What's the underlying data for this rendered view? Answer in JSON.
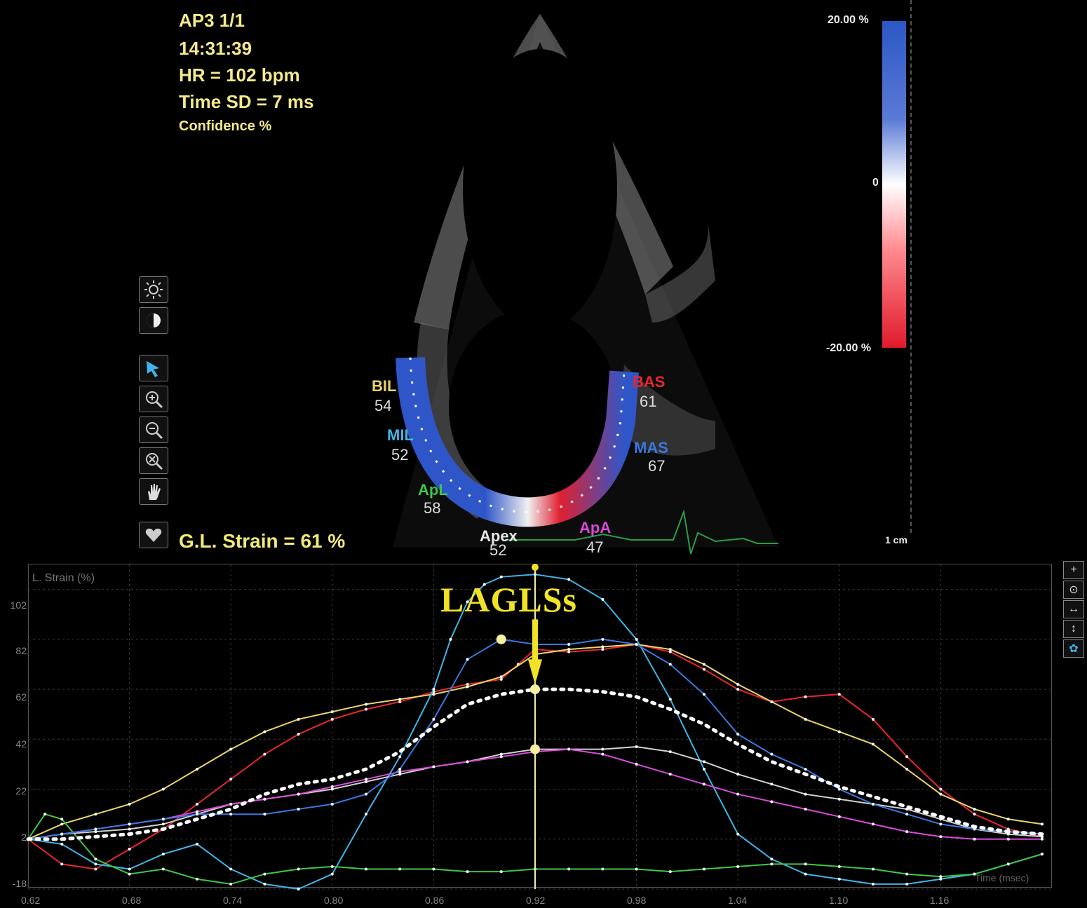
{
  "image_panel": {
    "info": {
      "view": "AP3  1/1",
      "time": "14:31:39",
      "hr": "HR = 102 bpm",
      "time_sd": "Time SD = 7 ms",
      "confidence": "Confidence %"
    },
    "global_strain": "G.L. Strain = 61 %",
    "color_scale": {
      "top_label": "20.00 %",
      "mid_label": "0",
      "bottom_label": "-20.00 %",
      "top_color": "#2b57c4",
      "bottom_color": "#e01a2a"
    },
    "depth_label": "1 cm",
    "segments": [
      {
        "id": "bil",
        "label": "BIL",
        "value": "54",
        "color": "#e8d46a"
      },
      {
        "id": "mil",
        "label": "MIL",
        "value": "52",
        "color": "#3fb5e8"
      },
      {
        "id": "apl",
        "label": "ApL",
        "value": "58",
        "color": "#3fc54a"
      },
      {
        "id": "apex",
        "label": "Apex",
        "value": "52",
        "color": "#e8e8e8"
      },
      {
        "id": "apa",
        "label": "ApA",
        "value": "47",
        "color": "#d94ad9"
      },
      {
        "id": "mas",
        "label": "MAS",
        "value": "67",
        "color": "#3a78e0"
      },
      {
        "id": "bas",
        "label": "BAS",
        "value": "61",
        "color": "#e8262e"
      }
    ],
    "tools": [
      "sun-icon",
      "contrast-icon",
      "pointer-icon",
      "zoom-in-icon",
      "zoom-out-icon",
      "zoom-reset-icon",
      "hand-icon",
      "heart-icon"
    ]
  },
  "graph": {
    "ylabel": "L. Strain (%)",
    "annotation": "LAGLSs",
    "xlabel": "Time (msec)",
    "tools": [
      "+",
      "⊙",
      "↔",
      "↕",
      "✿"
    ],
    "y_ticks": [
      "102",
      "82",
      "62",
      "42",
      "22",
      "2",
      "-18"
    ],
    "x_ticks": [
      "0.62",
      "0.68",
      "0.74",
      "0.80",
      "0.86",
      "0.92",
      "0.98",
      "1.04",
      "1.10",
      "1.16"
    ],
    "marker_time": "0.92"
  },
  "chart_data": {
    "type": "line",
    "ylabel": "L. Strain (%)",
    "xlabel": "Time (msec)",
    "ylim": [
      -18,
      112
    ],
    "xlim": [
      0.62,
      1.225
    ],
    "grid": true,
    "annotations": [
      "LAGLSs"
    ],
    "series": [
      {
        "name": "BAS",
        "color": "#e8262e",
        "x": [
          0.62,
          0.64,
          0.66,
          0.68,
          0.7,
          0.72,
          0.74,
          0.76,
          0.78,
          0.8,
          0.82,
          0.84,
          0.86,
          0.88,
          0.9,
          0.91,
          0.92,
          0.94,
          0.96,
          0.98,
          1.0,
          1.02,
          1.04,
          1.06,
          1.08,
          1.1,
          1.12,
          1.14,
          1.16,
          1.18,
          1.2,
          1.22
        ],
        "y": [
          2,
          -8,
          -10,
          -2,
          6,
          16,
          26,
          36,
          44,
          50,
          54,
          57,
          61,
          64,
          66,
          72,
          78,
          77,
          78,
          80,
          77,
          70,
          62,
          57,
          59,
          60,
          50,
          35,
          22,
          12,
          6,
          3
        ]
      },
      {
        "name": "BIL",
        "color": "#e8d46a",
        "x": [
          0.62,
          0.64,
          0.66,
          0.68,
          0.7,
          0.72,
          0.74,
          0.76,
          0.78,
          0.8,
          0.82,
          0.84,
          0.86,
          0.88,
          0.9,
          0.92,
          0.94,
          0.96,
          0.98,
          1.0,
          1.02,
          1.04,
          1.06,
          1.08,
          1.1,
          1.12,
          1.14,
          1.16,
          1.18,
          1.2,
          1.22
        ],
        "y": [
          2,
          8,
          12,
          16,
          22,
          30,
          38,
          45,
          50,
          53,
          56,
          58,
          60,
          63,
          67,
          76,
          78,
          79,
          80,
          78,
          72,
          64,
          57,
          50,
          45,
          40,
          30,
          20,
          14,
          10,
          8
        ]
      },
      {
        "name": "MIL",
        "color": "#3fb5e8",
        "x": [
          0.62,
          0.64,
          0.66,
          0.68,
          0.7,
          0.72,
          0.74,
          0.76,
          0.78,
          0.8,
          0.82,
          0.84,
          0.86,
          0.87,
          0.88,
          0.89,
          0.9,
          0.92,
          0.94,
          0.96,
          0.98,
          1.0,
          1.02,
          1.04,
          1.06,
          1.08,
          1.1,
          1.12,
          1.14,
          1.16,
          1.18,
          1.2,
          1.22
        ],
        "y": [
          2,
          0,
          -8,
          -10,
          -4,
          0,
          -10,
          -16,
          -18,
          -12,
          12,
          35,
          62,
          82,
          97,
          104,
          107,
          108,
          106,
          98,
          82,
          58,
          30,
          4,
          -6,
          -12,
          -14,
          -16,
          -16,
          -14,
          -12,
          -8,
          -4
        ]
      },
      {
        "name": "ApL",
        "color": "#3fc54a",
        "x": [
          0.62,
          0.63,
          0.64,
          0.66,
          0.68,
          0.7,
          0.72,
          0.74,
          0.76,
          0.78,
          0.8,
          0.82,
          0.84,
          0.86,
          0.88,
          0.9,
          0.92,
          0.94,
          0.96,
          0.98,
          1.0,
          1.02,
          1.04,
          1.06,
          1.08,
          1.1,
          1.12,
          1.14,
          1.16,
          1.18,
          1.2,
          1.22
        ],
        "y": [
          2,
          12,
          10,
          -6,
          -12,
          -10,
          -14,
          -16,
          -12,
          -10,
          -9,
          -10,
          -10,
          -10,
          -11,
          -11,
          -10,
          -10,
          -10,
          -10,
          -11,
          -10,
          -9,
          -8,
          -8,
          -9,
          -10,
          -12,
          -13,
          -12,
          -8,
          -4
        ]
      },
      {
        "name": "Apex",
        "color": "#d0d0d0",
        "x": [
          0.62,
          0.64,
          0.66,
          0.68,
          0.7,
          0.72,
          0.74,
          0.76,
          0.78,
          0.8,
          0.82,
          0.84,
          0.86,
          0.88,
          0.9,
          0.92,
          0.94,
          0.96,
          0.98,
          1.0,
          1.02,
          1.04,
          1.06,
          1.08,
          1.1,
          1.12,
          1.14,
          1.16,
          1.18,
          1.2,
          1.22
        ],
        "y": [
          2,
          4,
          5,
          6,
          8,
          12,
          16,
          18,
          20,
          22,
          25,
          28,
          31,
          33,
          36,
          38,
          38,
          38,
          39,
          37,
          33,
          28,
          24,
          20,
          18,
          16,
          14,
          10,
          6,
          4,
          3
        ]
      },
      {
        "name": "ApA",
        "color": "#d94ad9",
        "x": [
          0.62,
          0.64,
          0.66,
          0.68,
          0.7,
          0.72,
          0.74,
          0.76,
          0.78,
          0.8,
          0.82,
          0.84,
          0.86,
          0.88,
          0.9,
          0.92,
          0.94,
          0.96,
          0.98,
          1.0,
          1.02,
          1.04,
          1.06,
          1.08,
          1.1,
          1.12,
          1.14,
          1.16,
          1.18,
          1.2,
          1.22
        ],
        "y": [
          2,
          4,
          6,
          8,
          10,
          13,
          16,
          18,
          20,
          23,
          26,
          29,
          31,
          33,
          35,
          37,
          38,
          36,
          32,
          28,
          24,
          20,
          17,
          14,
          11,
          8,
          5,
          3,
          2,
          2,
          2
        ]
      },
      {
        "name": "MAS",
        "color": "#3a78e0",
        "x": [
          0.62,
          0.64,
          0.66,
          0.68,
          0.7,
          0.72,
          0.74,
          0.76,
          0.78,
          0.8,
          0.82,
          0.84,
          0.86,
          0.88,
          0.9,
          0.92,
          0.94,
          0.96,
          0.98,
          1.0,
          1.02,
          1.04,
          1.06,
          1.08,
          1.1,
          1.12,
          1.14,
          1.16,
          1.18,
          1.2,
          1.22
        ],
        "y": [
          2,
          4,
          6,
          8,
          10,
          12,
          12,
          12,
          14,
          16,
          20,
          30,
          50,
          74,
          82,
          80,
          80,
          82,
          80,
          72,
          60,
          44,
          36,
          30,
          22,
          16,
          12,
          8,
          6,
          5,
          4
        ]
      },
      {
        "name": "Average",
        "color": "#ffffff",
        "x": [
          0.62,
          0.64,
          0.66,
          0.68,
          0.7,
          0.72,
          0.74,
          0.76,
          0.78,
          0.8,
          0.82,
          0.84,
          0.86,
          0.88,
          0.9,
          0.92,
          0.94,
          0.96,
          0.98,
          1.0,
          1.02,
          1.04,
          1.06,
          1.08,
          1.1,
          1.12,
          1.14,
          1.16,
          1.18,
          1.2,
          1.22
        ],
        "y": [
          2,
          2,
          3,
          4,
          6,
          10,
          14,
          20,
          24,
          26,
          30,
          37,
          47,
          56,
          60,
          62,
          62,
          61,
          59,
          54,
          48,
          40,
          33,
          28,
          23,
          19,
          15,
          11,
          7,
          5,
          4
        ]
      }
    ]
  }
}
